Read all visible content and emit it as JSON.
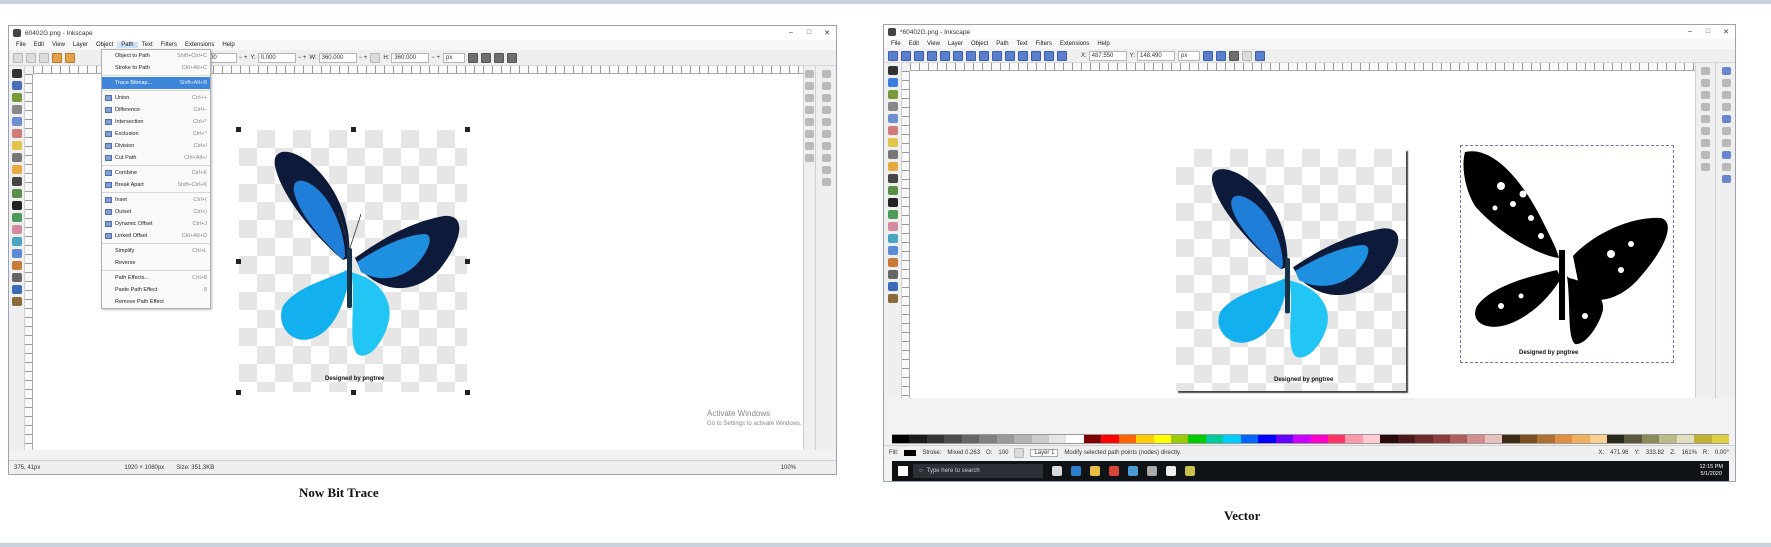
{
  "left_window": {
    "title": "60402G.png - Inkscape",
    "menu": [
      "File",
      "Edit",
      "View",
      "Layer",
      "Object",
      "Path",
      "Text",
      "Filters",
      "Extensions",
      "Help"
    ],
    "active_menu": "Path",
    "coords": {
      "x_label": "X:",
      "x": "0.000",
      "y_label": "Y:",
      "y": "0.000",
      "w_label": "W:",
      "w": "360.000",
      "h_label": "H:",
      "h": "360.000",
      "unit": "px"
    },
    "path_menu": [
      {
        "label": "Object to Path",
        "shortcut": "Shift+Ctrl+C"
      },
      {
        "label": "Stroke to Path",
        "shortcut": "Ctrl+Alt+C"
      },
      {
        "label": "Trace Bitmap...",
        "shortcut": "Shift+Alt+B",
        "highlight": true
      },
      {
        "label": "Union",
        "shortcut": "Ctrl++"
      },
      {
        "label": "Difference",
        "shortcut": "Ctrl+-"
      },
      {
        "label": "Intersection",
        "shortcut": "Ctrl+*"
      },
      {
        "label": "Exclusion",
        "shortcut": "Ctrl+^"
      },
      {
        "label": "Division",
        "shortcut": "Ctrl+/"
      },
      {
        "label": "Cut Path",
        "shortcut": "Ctrl+Alt+/"
      },
      {
        "label": "Combine",
        "shortcut": "Ctrl+K"
      },
      {
        "label": "Break Apart",
        "shortcut": "Shift+Ctrl+K"
      },
      {
        "label": "Inset",
        "shortcut": "Ctrl+("
      },
      {
        "label": "Outset",
        "shortcut": "Ctrl+)"
      },
      {
        "label": "Dynamic Offset",
        "shortcut": "Ctrl+J"
      },
      {
        "label": "Linked Offset",
        "shortcut": "Ctrl+Alt+D"
      },
      {
        "label": "Simplify",
        "shortcut": "Ctrl+L"
      },
      {
        "label": "Reverse",
        "shortcut": ""
      },
      {
        "label": "Path Effects...",
        "shortcut": "Ctrl+8"
      },
      {
        "label": "Paste Path Effect",
        "shortcut": "8"
      },
      {
        "label": "Remove Path Effect",
        "shortcut": ""
      }
    ],
    "image_credit": "Designed by pngtree",
    "status": {
      "cursor": "375, 41px",
      "dimensions": "1920 × 1080px",
      "size": "Size: 351.3KB",
      "zoom": "100%"
    },
    "watermark": {
      "line1": "Activate Windows",
      "line2": "Go to Settings to activate Windows."
    }
  },
  "right_window": {
    "title": "*60402G.png - Inkscape",
    "menu": [
      "File",
      "Edit",
      "View",
      "Layer",
      "Object",
      "Path",
      "Text",
      "Filters",
      "Extensions",
      "Help"
    ],
    "coords": {
      "x_label": "X:",
      "x": "487.550",
      "y_label": "Y:",
      "y": "148.490",
      "unit": "px"
    },
    "image_credit": "Designed by pngtree",
    "trace_credit": "Designed by pngtree",
    "status": {
      "fill_label": "Fill:",
      "stroke_label": "Stroke:",
      "stroke_value": "Mixed 0.263",
      "opacity_label": "O:",
      "opacity": "100",
      "layer": "Layer 1",
      "message": "Modify selected path points (nodes) directly.",
      "cursor_x_label": "X:",
      "cursor_x": "471.96",
      "cursor_y_label": "Y:",
      "cursor_y": "333.82",
      "zoom_label": "Z:",
      "zoom": "161%",
      "rotation_label": "R:",
      "rotation": "0.00°"
    },
    "taskbar": {
      "search_placeholder": "Type here to search",
      "time": "12:15 PM",
      "date": "5/1/2020"
    }
  },
  "captions": {
    "left": "Now Bit Trace",
    "right": "Vector"
  },
  "colors": {
    "butterfly_blue": "#1f8fe0",
    "menu_highlight": "#3e86d9",
    "taskbar": "#101316"
  }
}
